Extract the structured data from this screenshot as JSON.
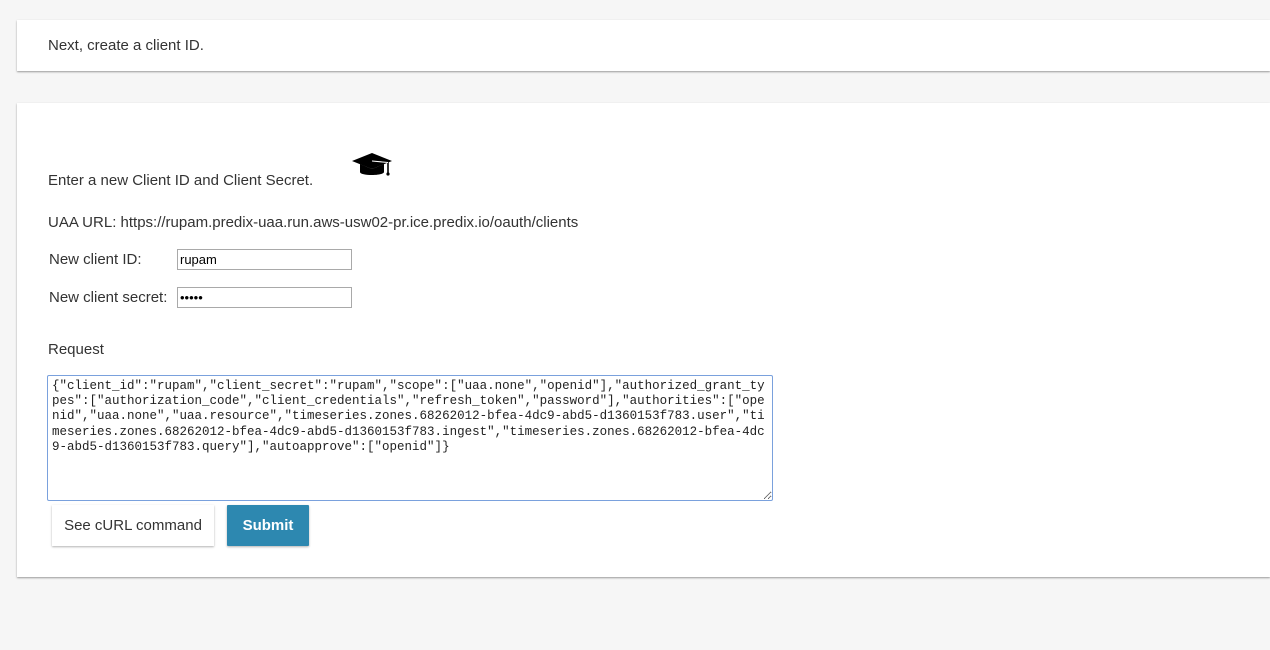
{
  "top_card": {
    "intro": "Next, create a client ID."
  },
  "main_card": {
    "heading": "Enter a new Client ID and Client Secret.",
    "heading_icon": "graduation-cap-icon",
    "uaa_url_line": "UAA URL: https://rupam.predix-uaa.run.aws-usw02-pr.ice.predix.io/oauth/clients",
    "client_id_label": "New client ID:",
    "client_id_value": "rupam",
    "client_secret_label": "New client secret:",
    "client_secret_value": "rupam",
    "request_label": "Request",
    "request_body": "{\"client_id\":\"rupam\",\"client_secret\":\"rupam\",\"scope\":[\"uaa.none\",\"openid\"],\"authorized_grant_types\":[\"authorization_code\",\"client_credentials\",\"refresh_token\",\"password\"],\"authorities\":[\"openid\",\"uaa.none\",\"uaa.resource\",\"timeseries.zones.68262012-bfea-4dc9-abd5-d1360153f783.user\",\"timeseries.zones.68262012-bfea-4dc9-abd5-d1360153f783.ingest\",\"timeseries.zones.68262012-bfea-4dc9-abd5-d1360153f783.query\"],\"autoapprove\":[\"openid\"]}",
    "curl_button_label": "See cURL command",
    "submit_button_label": "Submit"
  },
  "colors": {
    "background": "#f6f6f6",
    "card": "#ffffff",
    "submit_button": "#2d88b0",
    "textarea_focus_border": "#7aa1dd"
  }
}
